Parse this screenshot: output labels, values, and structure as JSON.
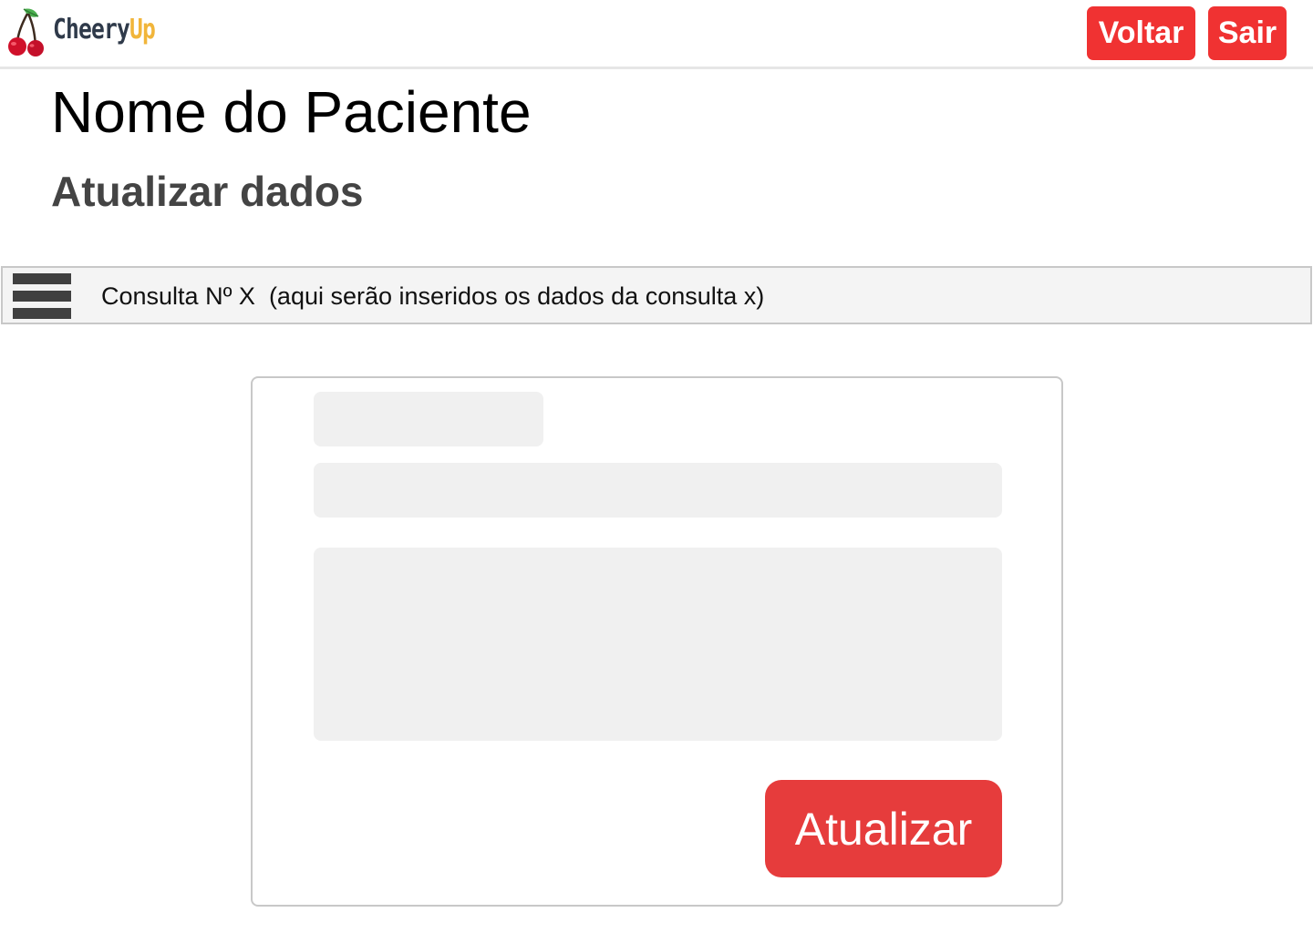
{
  "header": {
    "logo_text_part1": "Cheery",
    "logo_text_part2": "Up",
    "logo_icon": "cherry-icon",
    "voltar_label": "Voltar",
    "sair_label": "Sair"
  },
  "page": {
    "title": "Nome do Paciente",
    "subtitle": "Atualizar dados"
  },
  "consulta": {
    "menu_icon": "hamburger-menu-icon",
    "text": "Consulta Nº X  (aqui serão inseridos os dados da consulta x)"
  },
  "form": {
    "field1_value": "",
    "field2_value": "",
    "field3_value": "",
    "submit_label": "Atualizar"
  },
  "colors": {
    "accent_red": "#f03232",
    "submit_red": "#e63c3c",
    "logo_dark": "#2f3a4a",
    "logo_yellow": "#f1b53a",
    "field_bg": "#f0f0f0"
  }
}
